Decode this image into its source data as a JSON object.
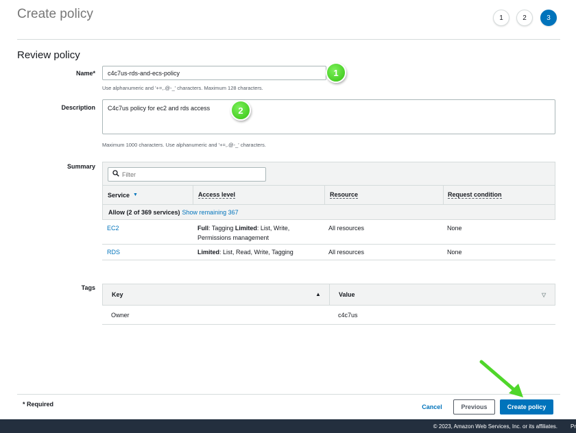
{
  "page": {
    "title": "Create policy",
    "steps": [
      "1",
      "2",
      "3"
    ],
    "active_step": "3",
    "section_title": "Review policy"
  },
  "form": {
    "name_label": "Name*",
    "name_value": "c4c7us-rds-and-ecs-policy",
    "name_help": "Use alphanumeric and '+=,.@-_' characters. Maximum 128 characters.",
    "description_label": "Description",
    "description_value": "C4c7us policy for ec2 and rds access",
    "description_help": "Maximum 1000 characters. Use alphanumeric and '+=,.@-_' characters."
  },
  "markers": [
    "1",
    "2"
  ],
  "summary": {
    "label": "Summary",
    "filter_placeholder": "Filter",
    "columns": [
      "Service",
      "Access level",
      "Resource",
      "Request condition"
    ],
    "allow_text": "Allow (2 of 369 services)",
    "show_remaining": "Show remaining 367",
    "rows": [
      {
        "service": "EC2",
        "access_bold_1": "Full",
        "access_text_1": ": Tagging ",
        "access_bold_2": "Limited",
        "access_text_2": ": List, Write,",
        "access_line_2": "Permissions management",
        "resource": "All resources",
        "condition": "None"
      },
      {
        "service": "RDS",
        "access_bold_1": "Limited",
        "access_text_1": ": List, Read, Write, Tagging",
        "resource": "All resources",
        "condition": "None"
      }
    ]
  },
  "tags": {
    "label": "Tags",
    "columns": [
      "Key",
      "Value"
    ],
    "rows": [
      {
        "key": "Owner",
        "value": "c4c7us"
      }
    ]
  },
  "footer": {
    "required": "* Required",
    "cancel": "Cancel",
    "previous": "Previous",
    "create": "Create policy"
  },
  "bottom_bar": {
    "copyright": "© 2023, Amazon Web Services, Inc. or its affiliates.",
    "privacy": "Privacy"
  },
  "colors": {
    "accent": "#0073bb",
    "marker_green": "#35c212",
    "footer_bg": "#232f3e"
  }
}
